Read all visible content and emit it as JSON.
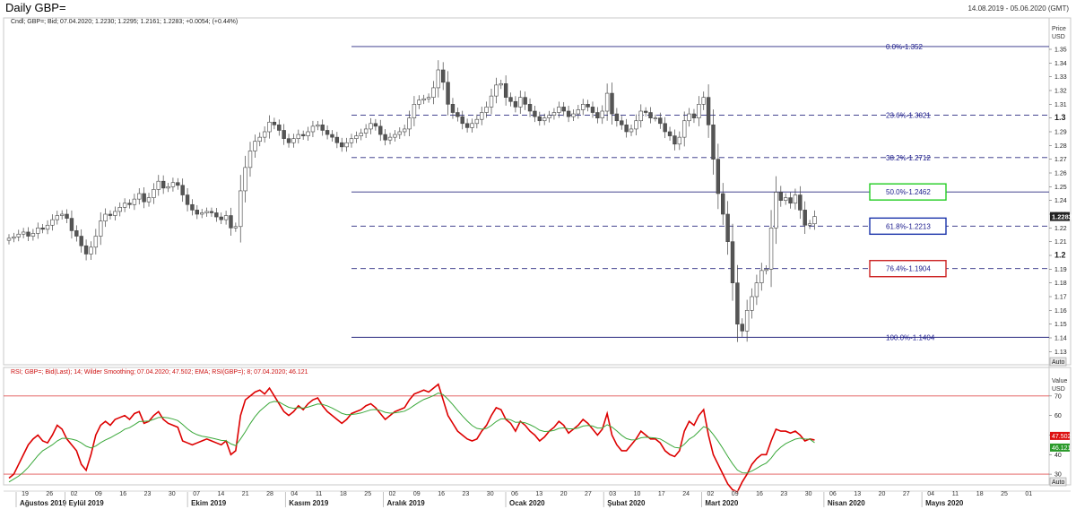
{
  "header": {
    "title": "Daily GBP=",
    "date_range": "14.08.2019 - 05.06.2020 (GMT)"
  },
  "chart_data": [
    {
      "type": "candlestick",
      "legend_text": "Cndl; GBP=; Bid; 07.04.2020; 1.2230; 1.2295; 1.2161; 1.2283; +0.0054; (+0.44%)",
      "y_axis_title_1": "Price",
      "y_axis_title_2": "USD",
      "ylim": [
        1.125,
        1.365
      ],
      "y_ticks": [
        "1.13",
        "1.14",
        "1.15",
        "1.16",
        "1.17",
        "1.18",
        "1.19",
        "1.2",
        "1.21",
        "1.22",
        "1.23",
        "1.24",
        "1.25",
        "1.26",
        "1.27",
        "1.28",
        "1.29",
        "1.3",
        "1.31",
        "1.32",
        "1.33",
        "1.34",
        "1.35"
      ],
      "y_ticks_bold": [
        "1.2",
        "1.3"
      ],
      "last_price_label": "1.2283",
      "last_price": 1.2283,
      "auto_label": "Auto",
      "fibonacci": [
        {
          "label": "0.0%-1.352",
          "value": 1.352,
          "style": "solid",
          "box": ""
        },
        {
          "label": "23.6%-1.3021",
          "value": 1.3021,
          "style": "dashed",
          "box": ""
        },
        {
          "label": "38.2%-1.2712",
          "value": 1.2712,
          "style": "dashed",
          "box": ""
        },
        {
          "label": "50.0%-1.2462",
          "value": 1.2462,
          "style": "solid",
          "box": "#22cc22"
        },
        {
          "label": "61.8%-1.2213",
          "value": 1.2213,
          "style": "dashed",
          "box": "#1a33aa"
        },
        {
          "label": "76.4%-1.1904",
          "value": 1.1904,
          "style": "dashed",
          "box": "#cc2222"
        },
        {
          "label": "100.0%-1.1404",
          "value": 1.1404,
          "style": "solid",
          "box": ""
        }
      ],
      "closes": [
        1.2125,
        1.2135,
        1.2155,
        1.217,
        1.214,
        1.216,
        1.22,
        1.219,
        1.222,
        1.226,
        1.229,
        1.23,
        1.227,
        1.218,
        1.214,
        1.207,
        1.201,
        1.206,
        1.214,
        1.225,
        1.23,
        1.229,
        1.232,
        1.235,
        1.238,
        1.237,
        1.241,
        1.245,
        1.239,
        1.242,
        1.248,
        1.254,
        1.249,
        1.25,
        1.253,
        1.251,
        1.244,
        1.237,
        1.233,
        1.23,
        1.231,
        1.232,
        1.231,
        1.228,
        1.226,
        1.229,
        1.22,
        1.221,
        1.247,
        1.264,
        1.276,
        1.283,
        1.286,
        1.29,
        1.297,
        1.295,
        1.291,
        1.285,
        1.282,
        1.285,
        1.288,
        1.287,
        1.29,
        1.294,
        1.295,
        1.291,
        1.288,
        1.286,
        1.282,
        1.279,
        1.282,
        1.285,
        1.287,
        1.289,
        1.292,
        1.296,
        1.294,
        1.288,
        1.284,
        1.286,
        1.288,
        1.29,
        1.292,
        1.3,
        1.31,
        1.313,
        1.314,
        1.315,
        1.322,
        1.335,
        1.326,
        1.31,
        1.304,
        1.301,
        1.296,
        1.293,
        1.296,
        1.299,
        1.304,
        1.308,
        1.316,
        1.324,
        1.325,
        1.315,
        1.312,
        1.308,
        1.315,
        1.31,
        1.305,
        1.301,
        1.298,
        1.3,
        1.302,
        1.304,
        1.308,
        1.305,
        1.301,
        1.303,
        1.306,
        1.31,
        1.308,
        1.304,
        1.3,
        1.305,
        1.318,
        1.303,
        1.298,
        1.295,
        1.29,
        1.292,
        1.298,
        1.305,
        1.304,
        1.3,
        1.3,
        1.296,
        1.29,
        1.287,
        1.281,
        1.286,
        1.298,
        1.303,
        1.3,
        1.31,
        1.315,
        1.295,
        1.27,
        1.245,
        1.23,
        1.21,
        1.18,
        1.15,
        1.145,
        1.16,
        1.17,
        1.18,
        1.189,
        1.19,
        1.22,
        1.246,
        1.24,
        1.242,
        1.238,
        1.244,
        1.233,
        1.222,
        1.223,
        1.2283
      ],
      "rsi_legend": "RSI; GBP=; Bid(Last); 14; Wilder Smoothing; 07.04.2020; 47.502; EMA; RSI(GBP=); 8; 07.04.2020; 46.121",
      "rsi_axis_title_1": "Value",
      "rsi_axis_title_2": "USD",
      "rsi_ylim": [
        25,
        80
      ],
      "rsi_ticks": [
        "30",
        "40",
        "50",
        "60",
        "70"
      ],
      "rsi_bands": [
        70,
        30
      ],
      "rsi_last_label": "47.502",
      "rsi_last": 47.502,
      "ema_last_label": "46.121",
      "ema_last": 46.121,
      "rsi_values": [
        28,
        30,
        35,
        40,
        45,
        48,
        50,
        47,
        46,
        50,
        55,
        53,
        48,
        45,
        42,
        35,
        32,
        40,
        50,
        55,
        57,
        55,
        58,
        59,
        60,
        58,
        61,
        62,
        56,
        57,
        60,
        62,
        58,
        56,
        55,
        54,
        47,
        46,
        45,
        46,
        47,
        48,
        47,
        46,
        45,
        47,
        40,
        42,
        60,
        68,
        70,
        72,
        73,
        71,
        74,
        70,
        66,
        62,
        60,
        62,
        65,
        63,
        66,
        68,
        69,
        65,
        62,
        60,
        58,
        56,
        58,
        61,
        62,
        63,
        65,
        66,
        64,
        61,
        58,
        60,
        62,
        63,
        64,
        68,
        71,
        72,
        73,
        72,
        74,
        76,
        68,
        60,
        56,
        52,
        50,
        48,
        47,
        48,
        52,
        55,
        60,
        64,
        63,
        58,
        56,
        52,
        57,
        55,
        52,
        50,
        47,
        49,
        52,
        54,
        57,
        55,
        51,
        53,
        55,
        58,
        56,
        53,
        50,
        53,
        61,
        50,
        45,
        42,
        42,
        45,
        48,
        52,
        50,
        48,
        48,
        46,
        42,
        40,
        39,
        42,
        52,
        57,
        55,
        60,
        63,
        50,
        40,
        35,
        30,
        25,
        22,
        21,
        26,
        30,
        35,
        38,
        40,
        40,
        47,
        53,
        52,
        52,
        51,
        52,
        50,
        47,
        48,
        47.5
      ],
      "ema_values": [
        26,
        27.5,
        29,
        31,
        33.5,
        36.5,
        39.5,
        42,
        43.5,
        45,
        47,
        48.3,
        48.3,
        47.9,
        47.3,
        46,
        44.3,
        43.4,
        44.4,
        46.1,
        47.5,
        48.6,
        50,
        51.3,
        53,
        53.8,
        55.3,
        56.9,
        57,
        57.2,
        58,
        59,
        59.1,
        58.8,
        58.2,
        57.4,
        55.4,
        53.2,
        51.4,
        50.2,
        49.4,
        49,
        48.5,
        47.9,
        47.3,
        47.1,
        45.5,
        44.6,
        48,
        51.7,
        55.8,
        59.4,
        62.3,
        64.4,
        66.5,
        67.2,
        66.9,
        65.5,
        64.2,
        63.7,
        64,
        63.8,
        64.3,
        65.1,
        65.9,
        65.7,
        64.9,
        63.8,
        62.5,
        61.1,
        60.4,
        60.5,
        60.8,
        61.3,
        62.1,
        62.9,
        63.1,
        62.6,
        61.6,
        61.2,
        61.4,
        61.7,
        62.2,
        63.5,
        65.2,
        66.8,
        68.2,
        69.1,
        70.2,
        71.5,
        70.7,
        68.3,
        65.6,
        62.6,
        59.8,
        57.2,
        54.9,
        53.4,
        53,
        53.4,
        54.9,
        56.9,
        58.3,
        58.3,
        57.8,
        56.5,
        56.6,
        56.3,
        55.3,
        54.1,
        52.5,
        51.8,
        51.9,
        52.4,
        53.4,
        53.7,
        53.2,
        53.2,
        53.6,
        54.6,
        54.9,
        54.6,
        53.6,
        53.6,
        55.3,
        54.1,
        52.1,
        49.9,
        48.2,
        47.5,
        47.6,
        48.6,
        48.9,
        48.7,
        48.5,
        48,
        46.6,
        45.1,
        43.7,
        43.4,
        45.3,
        47.9,
        49.4,
        51.8,
        54.3,
        53.3,
        50.3,
        46.9,
        43.1,
        39.1,
        35.3,
        32.1,
        30.7,
        30.6,
        31.6,
        33,
        34.5,
        35.7,
        38.2,
        41.5,
        43.8,
        45.6,
        46.8,
        47.9,
        48.4,
        48,
        47.9,
        46.121
      ]
    }
  ],
  "x_axis": {
    "days": [
      "19",
      "26",
      "02",
      "09",
      "16",
      "23",
      "30",
      "07",
      "14",
      "21",
      "28",
      "04",
      "11",
      "18",
      "25",
      "02",
      "09",
      "16",
      "23",
      "30",
      "06",
      "13",
      "20",
      "27",
      "03",
      "10",
      "17",
      "24",
      "02",
      "09",
      "16",
      "23",
      "30",
      "06",
      "13",
      "20",
      "27",
      "04",
      "11",
      "18",
      "25",
      "01"
    ],
    "months": [
      "Ağustos 2019",
      "Eylül 2019",
      "Ekim 2019",
      "Kasım 2019",
      "Aralık 2019",
      "Ocak 2020",
      "Şubat 2020",
      "Mart 2020",
      "Nisan 2020",
      "Mayıs 2020"
    ]
  }
}
